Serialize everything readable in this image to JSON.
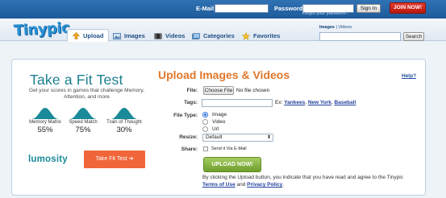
{
  "topbar": {
    "email_label": "E-Mail:",
    "email_value": "",
    "password_label": "Password:",
    "password_value": "",
    "forgot_link": "Forgot your password?",
    "signin_label": "Sign In",
    "join_label": "JOIN NOW!",
    "join_color": "#c8241a"
  },
  "brand": {
    "logo_text": "Tinypic",
    "logo_color": "#2a8fd2"
  },
  "nav": {
    "tabs": [
      {
        "label": "Upload",
        "icon": "upload-arrow-icon",
        "active": true
      },
      {
        "label": "Images",
        "icon": "images-icon",
        "active": false
      },
      {
        "label": "Videos",
        "icon": "videos-icon",
        "active": false
      },
      {
        "label": "Categories",
        "icon": "categories-icon",
        "active": false
      },
      {
        "label": "Favorites",
        "icon": "star-icon",
        "active": false
      }
    ]
  },
  "search": {
    "scope_selected": "Images",
    "separator": " | ",
    "scope_other": "Videos",
    "input_value": "",
    "button_label": "Search"
  },
  "ad": {
    "title": "Take a Fit Test",
    "subtitle": "Get your scores in games that challenge Memory, Attention, and more",
    "metrics": [
      {
        "name": "Memory Matrix",
        "value": "55%"
      },
      {
        "name": "Speed Match",
        "value": "75%"
      },
      {
        "name": "Train of Thought",
        "value": "30%"
      }
    ],
    "brand": "lumosity",
    "cta": "Take Fit Test ➔",
    "accent": "#1b7f90",
    "cta_color": "#f0663a"
  },
  "form": {
    "title": "Upload Images & Videos",
    "help": "Help?",
    "file_label": "File:",
    "file_button": "Choose File",
    "file_status": "No file chosen",
    "tags_label": "Tags:",
    "tags_value": "",
    "tags_example_prefix": "Ex: ",
    "tags_examples": [
      "Yankees",
      "New York",
      "Baseball"
    ],
    "filetype_label": "File Type:",
    "filetypes": [
      {
        "label": "Image",
        "selected": true
      },
      {
        "label": "Video",
        "selected": false
      },
      {
        "label": "Url",
        "selected": false
      }
    ],
    "resize_label": "Resize:",
    "resize_value": "Default",
    "share_label": "Share:",
    "share_option": "Send it Via E-Mail",
    "upload_button": "UPLOAD NOW!",
    "terms_text_1": "By clicking the Upload button, you indicate that you have read and agree to the Tinypic",
    "terms_link": "Terms of Use",
    "terms_and": " and ",
    "privacy_link": "Privacy Policy",
    "terms_end": "."
  }
}
